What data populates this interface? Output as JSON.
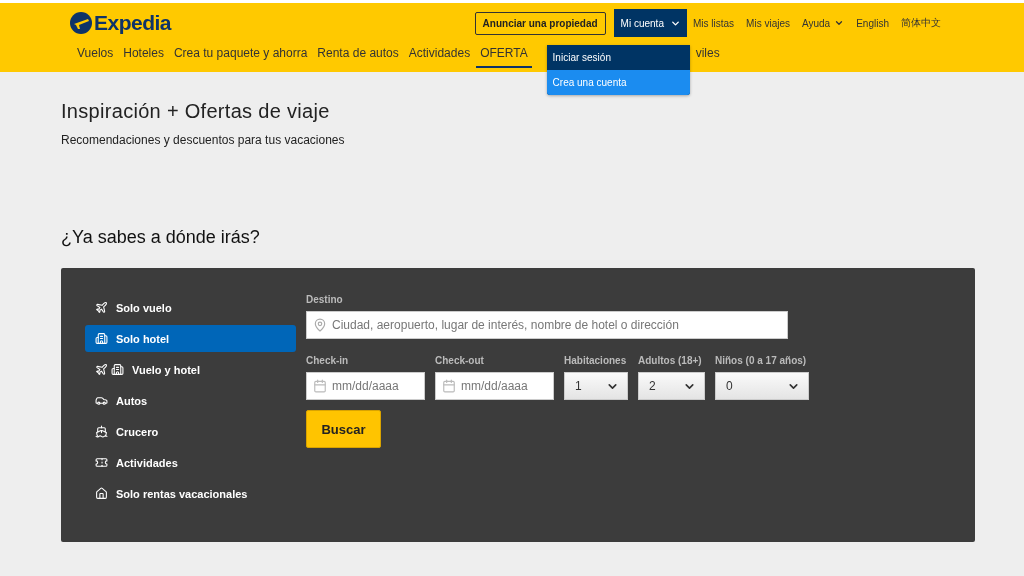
{
  "header": {
    "logo": "Expedia",
    "top_links": [
      {
        "kind": "outline",
        "label": "Anunciar una propiedad"
      },
      {
        "kind": "account",
        "label": "Mi cuenta",
        "expanded": true
      },
      {
        "kind": "link",
        "label": "Mis listas"
      },
      {
        "kind": "link",
        "label": "Mis viajes"
      },
      {
        "kind": "dropdown",
        "label": "Ayuda"
      },
      {
        "kind": "link",
        "label": "English"
      },
      {
        "kind": "link",
        "label": "简体中文"
      }
    ],
    "account_menu": [
      {
        "label": "Iniciar sesión",
        "selected": false
      },
      {
        "label": "Crea una cuenta",
        "selected": true
      }
    ],
    "nav": [
      {
        "label": "Vuelos",
        "selected": false
      },
      {
        "label": "Hoteles",
        "selected": false
      },
      {
        "label": "Crea tu paquete y ahorra",
        "selected": false
      },
      {
        "label": "Renta de autos",
        "selected": false
      },
      {
        "label": "Actividades",
        "selected": false
      },
      {
        "label": "OFERTA",
        "selected": true
      },
      {
        "label": "viles",
        "selected": false,
        "kind": "cut"
      }
    ]
  },
  "title": "Inspiración + Ofertas de viaje",
  "subtitle": "Recomendaciones y descuentos para tus vacaciones",
  "search_heading": "¿Ya sabes a dónde irás?",
  "search": {
    "tabs": [
      {
        "kind": "flight",
        "label": "Solo vuelo",
        "selected": false
      },
      {
        "kind": "hotel",
        "label": "Solo hotel",
        "selected": true
      },
      {
        "kind": "flight_hotel",
        "label": "Vuelo y hotel",
        "selected": false
      },
      {
        "kind": "car",
        "label": "Autos",
        "selected": false
      },
      {
        "kind": "cruise",
        "label": "Crucero",
        "selected": false
      },
      {
        "kind": "activity",
        "label": "Actividades",
        "selected": false
      },
      {
        "kind": "rental",
        "label": "Solo rentas vacacionales",
        "selected": false
      }
    ],
    "destination": {
      "label": "Destino",
      "placeholder": "Ciudad, aeropuerto, lugar de interés, nombre de hotel o dirección"
    },
    "fields": [
      {
        "kind": "date",
        "label": "Check-in",
        "placeholder": "mm/dd/aaaa"
      },
      {
        "kind": "date",
        "label": "Check-out",
        "placeholder": "mm/dd/aaaa"
      },
      {
        "kind": "select",
        "label": "Habitaciones",
        "value": "1"
      },
      {
        "kind": "select",
        "label": "Adultos (18+)",
        "value": "2"
      },
      {
        "kind": "select",
        "label": "Niños (0 a 17 años)",
        "value": "0"
      }
    ],
    "button": "Buscar"
  }
}
